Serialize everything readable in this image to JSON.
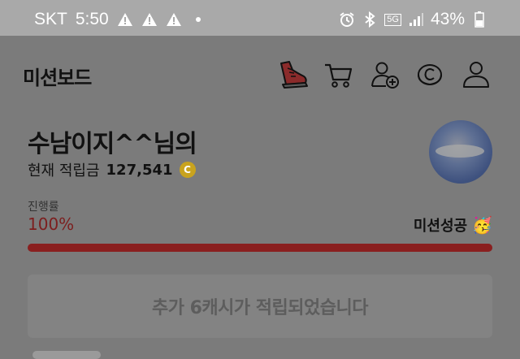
{
  "status_bar": {
    "carrier": "SKT",
    "time": "5:50",
    "network": "5G",
    "battery": "43%"
  },
  "app": {
    "title": "미션보드"
  },
  "nav": {
    "icons": [
      "shoe-icon",
      "cart-icon",
      "add-friend-icon",
      "coin-c-icon",
      "profile-icon"
    ]
  },
  "user": {
    "greeting": "수남이지^^님의",
    "points_label": "현재 적립금",
    "points_value": "127,541",
    "coin_symbol": "C"
  },
  "progress": {
    "label": "진행률",
    "value_text": "100%",
    "fraction": 1.0,
    "status_text": "미션성공",
    "status_emoji": "🥳"
  },
  "notice": {
    "text": "추가 6캐시가 적립되었습니다"
  },
  "colors": {
    "accent": "#8a1f1f",
    "overlay_bg": "#7b7b7b",
    "coin": "#c9a31e"
  }
}
